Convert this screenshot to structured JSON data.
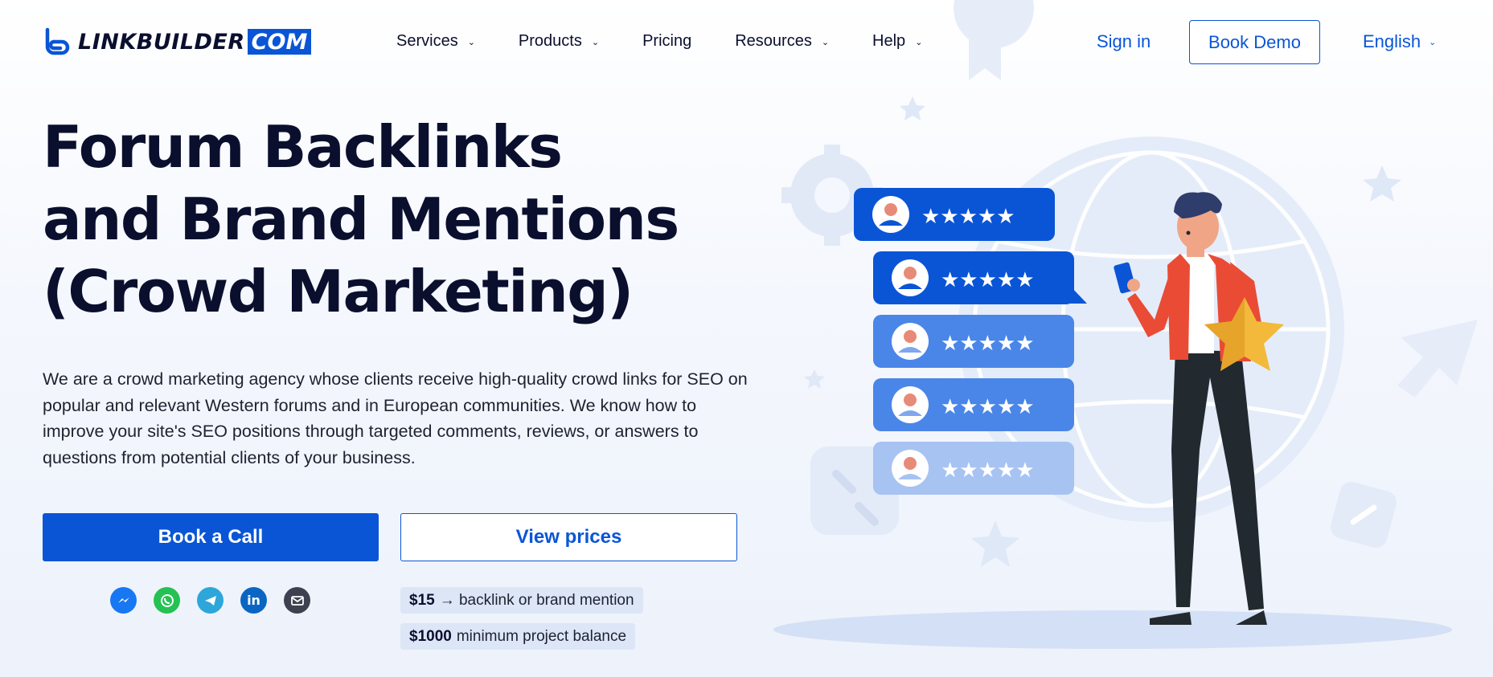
{
  "header": {
    "logo_text": "LINKBUILDER",
    "logo_suffix": "COM",
    "nav": [
      {
        "label": "Services",
        "has_dropdown": true
      },
      {
        "label": "Products",
        "has_dropdown": true
      },
      {
        "label": "Pricing",
        "has_dropdown": false
      },
      {
        "label": "Resources",
        "has_dropdown": true
      },
      {
        "label": "Help",
        "has_dropdown": true
      }
    ],
    "sign_in": "Sign in",
    "book_demo": "Book Demo",
    "language": "English"
  },
  "hero": {
    "title_lines": [
      "Forum Backlinks",
      "and Brand Mentions",
      "(Crowd Marketing)"
    ],
    "description": "We are a crowd marketing agency whose clients receive high-quality crowd links for SEO on popular and relevant Western forums and in European communities. We know how to improve your site's SEO positions through targeted comments, reviews, or answers to questions from potential clients of your business.",
    "primary_button": "Book a Call",
    "secondary_button": "View prices",
    "socials": [
      "messenger-icon",
      "whatsapp-icon",
      "telegram-icon",
      "linkedin-icon",
      "email-icon"
    ],
    "pricing": [
      {
        "amount": "$15",
        "text": "→ backlink or brand mention"
      },
      {
        "amount": "$1000",
        "text": "minimum project balance"
      }
    ]
  },
  "illustration": {
    "review_cards": [
      {
        "stars": 5,
        "shade": "dark"
      },
      {
        "stars": 5,
        "shade": "dark"
      },
      {
        "stars": 5,
        "shade": "medium"
      },
      {
        "stars": 5,
        "shade": "medium"
      },
      {
        "stars": 5,
        "shade": "light"
      }
    ]
  },
  "colors": {
    "brand_blue": "#0a55d6",
    "text_dark": "#0b0f2e",
    "pill_bg": "#dce6f7"
  }
}
